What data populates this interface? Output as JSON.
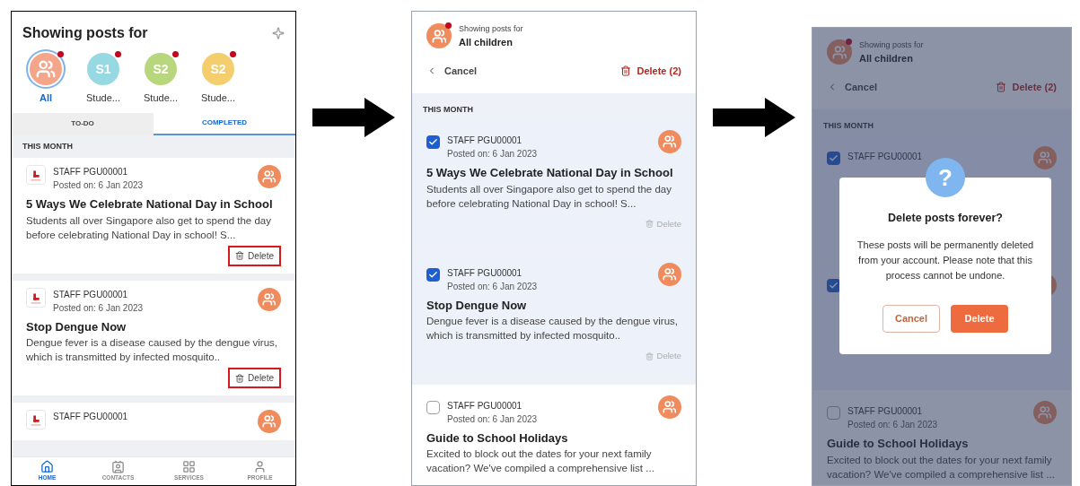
{
  "screens": [
    {
      "kind": "feed",
      "title": "Showing posts for",
      "filters": [
        {
          "label": "All",
          "unread": true,
          "selected": true,
          "color": "#f4a58a"
        },
        {
          "label": "Stude...",
          "text": "S1",
          "unread": true,
          "selected": false,
          "color": "#97d9e3"
        },
        {
          "label": "Stude...",
          "text": "S2",
          "unread": true,
          "selected": false,
          "color": "#b8d67c"
        },
        {
          "label": "Stude...",
          "text": "S2",
          "unread": true,
          "selected": false,
          "color": "#f4cd6c"
        }
      ],
      "tabs": [
        {
          "label": "TO-DO",
          "selected": false
        },
        {
          "label": "COMPLETED",
          "selected": true
        }
      ],
      "section": "THIS MONTH",
      "posts": [
        {
          "author": "STAFF PGU00001",
          "date": "Posted on: 6 Jan 2023",
          "title": "5 Ways We Celebrate National Day in School",
          "excerpt": "Students all over Singapore also get to spend the day before celebrating National Day in school! S...",
          "action": "Delete",
          "highlighted": true
        },
        {
          "author": "STAFF PGU00001",
          "date": "Posted on: 6 Jan 2023",
          "title": "Stop Dengue Now",
          "excerpt": "Dengue fever is a disease caused by the dengue virus, which is transmitted by infected mosquito..",
          "action": "Delete",
          "highlighted": true
        },
        {
          "author": "STAFF PGU00001"
        }
      ],
      "nav": [
        {
          "label": "HOME",
          "selected": true
        },
        {
          "label": "CONTACTS",
          "selected": false
        },
        {
          "label": "SERVICES",
          "selected": false
        },
        {
          "label": "PROFILE",
          "selected": false
        }
      ]
    },
    {
      "kind": "select",
      "caption": "Showing posts for",
      "audience": "All children",
      "unread": true,
      "cancel": "Cancel",
      "delete": "Delete (2)",
      "section": "THIS MONTH",
      "posts": [
        {
          "author": "STAFF PGU00001",
          "date": "Posted on: 6 Jan 2023",
          "title": "5 Ways We Celebrate National Day in School",
          "excerpt": "Students all over Singapore also get to spend the day before celebrating National Day in school! S...",
          "action": "Delete",
          "checked": true
        },
        {
          "author": "STAFF PGU00001",
          "date": "Posted on: 6 Jan 2023",
          "title": "Stop Dengue Now",
          "excerpt": "Dengue fever is a disease caused by the dengue virus, which is transmitted by infected mosquito..",
          "action": "Delete",
          "checked": true
        },
        {
          "author": "STAFF PGU00001",
          "date": "Posted on: 6 Jan 2023",
          "title": "Guide to School Holidays",
          "excerpt": "Excited to block out the dates for your next family vacation? We've compiled a comprehensive list ...",
          "checked": false
        }
      ]
    },
    {
      "kind": "dialog",
      "caption": "Showing posts for",
      "audience": "All children",
      "unread": true,
      "cancel": "Cancel",
      "delete": "Delete (2)",
      "section": "THIS MONTH",
      "posts": [
        {
          "author": "STAFF PGU00001",
          "checked": true
        },
        {
          "checked": true
        },
        {
          "author": "STAFF PGU00001",
          "date": "Posted on: 6 Jan 2023",
          "title": "Guide to School Holidays",
          "excerpt": "Excited to block out the dates for your next family vacation? We've compiled a comprehensive list ...",
          "checked": false
        }
      ],
      "dialog": {
        "icon": "?",
        "title": "Delete posts forever?",
        "message": "These posts will be permanently deleted from your account. Please note that this process cannot be undone.",
        "buttons": [
          {
            "label": "Cancel",
            "kind": "secondary"
          },
          {
            "label": "Delete",
            "kind": "primary"
          }
        ]
      }
    }
  ]
}
